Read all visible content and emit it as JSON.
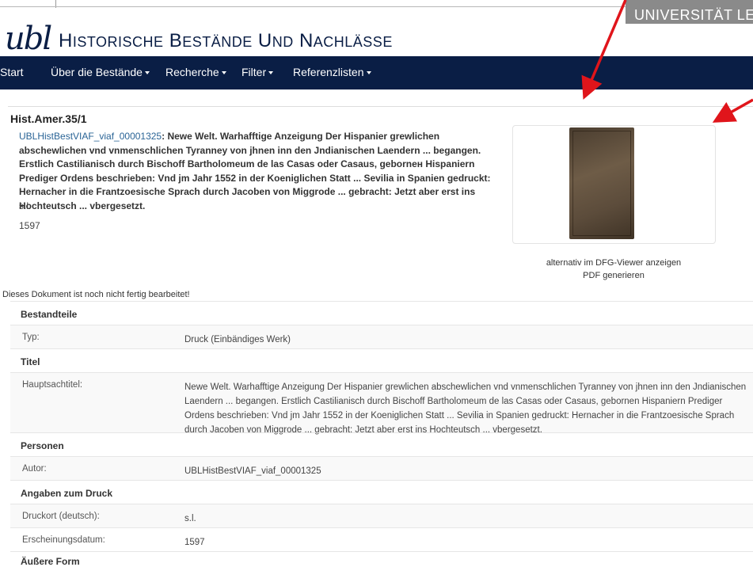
{
  "header": {
    "university": "UNIVERSITÄT LEIPZIG",
    "logo": "ubl",
    "title": "Historische Bestände und Nachlässe"
  },
  "nav": {
    "start": "Start",
    "bestaende": "Über die Bestände",
    "recherche": "Recherche",
    "filter": "Filter",
    "referenzlisten": "Referenzlisten"
  },
  "record": {
    "shelfmark": "Hist.Amer.35/1",
    "author_link": "UBLHistBestVIAF_viaf_00001325",
    "title_text": ": Newe Welt. Warhafftige Anzeigung Der Hispanier grewlichen abschewlichen vnd vnmenschlichen Tyranney von jhnen inn den Jndianischen Laendern ... begangen. Erstlich Castilianisch durch Bischoff Bartholomeum de las Casas oder Casaus, geborneн Hispaniern Prediger Ordens beschrieben: Vnd jm Jahr 1552 in der Koeniglichen Statt ... Sevilia in Spanien gedruckt: Hernacher in die Frantzoesische Sprach durch Jacoben von Miggrode ... gebracht: Jetzt aber erst ins Hochteutsch ... vbergesetzt.",
    "place": "s.l.",
    "year": "1597"
  },
  "viewer": {
    "dfg_link": "alternativ im DFG-Viewer anzeigen",
    "pdf_link": "PDF generieren"
  },
  "status_text": "Dieses Dokument ist noch nicht fertig bearbeitet!",
  "table": {
    "bestandteile": "Bestandteile",
    "typ_label": "Typ:",
    "typ_value": "Druck (Einbändiges Werk)",
    "titel": "Titel",
    "haupt_label": "Hauptsachtitel:",
    "haupt_value": "Newe Welt. Warhafftige Anzeigung Der Hispanier grewlichen abschewlichen vnd vnmenschlichen Tyranney von jhnen inn den Jndianischen Laendern ... begangen. Erstlich Castilianisch durch Bischoff Bartholomeum de las Casas oder Casaus, gebornen Hispaniern Prediger Ordens beschrieben: Vnd jm Jahr 1552 in der Koeniglichen Statt ... Sevilia in Spanien gedruckt: Hernacher in die Frantzoesische Sprach durch Jacoben von Miggrode ... gebracht: Jetzt aber erst ins Hochteutsch ... vbergesetzt.",
    "personen": "Personen",
    "autor_label": "Autor:",
    "autor_value": "UBLHistBestVIAF_viaf_00001325",
    "druck": "Angaben zum Druck",
    "druckort_label": "Druckort (deutsch):",
    "druckort_value": "s.l.",
    "datum_label": "Erscheinungsdatum:",
    "datum_value": "1597",
    "form": "Äußere Form"
  },
  "colors": {
    "navy": "#0a1e45",
    "link": "#2a6496",
    "annotation_arrow": "#e0151b"
  }
}
